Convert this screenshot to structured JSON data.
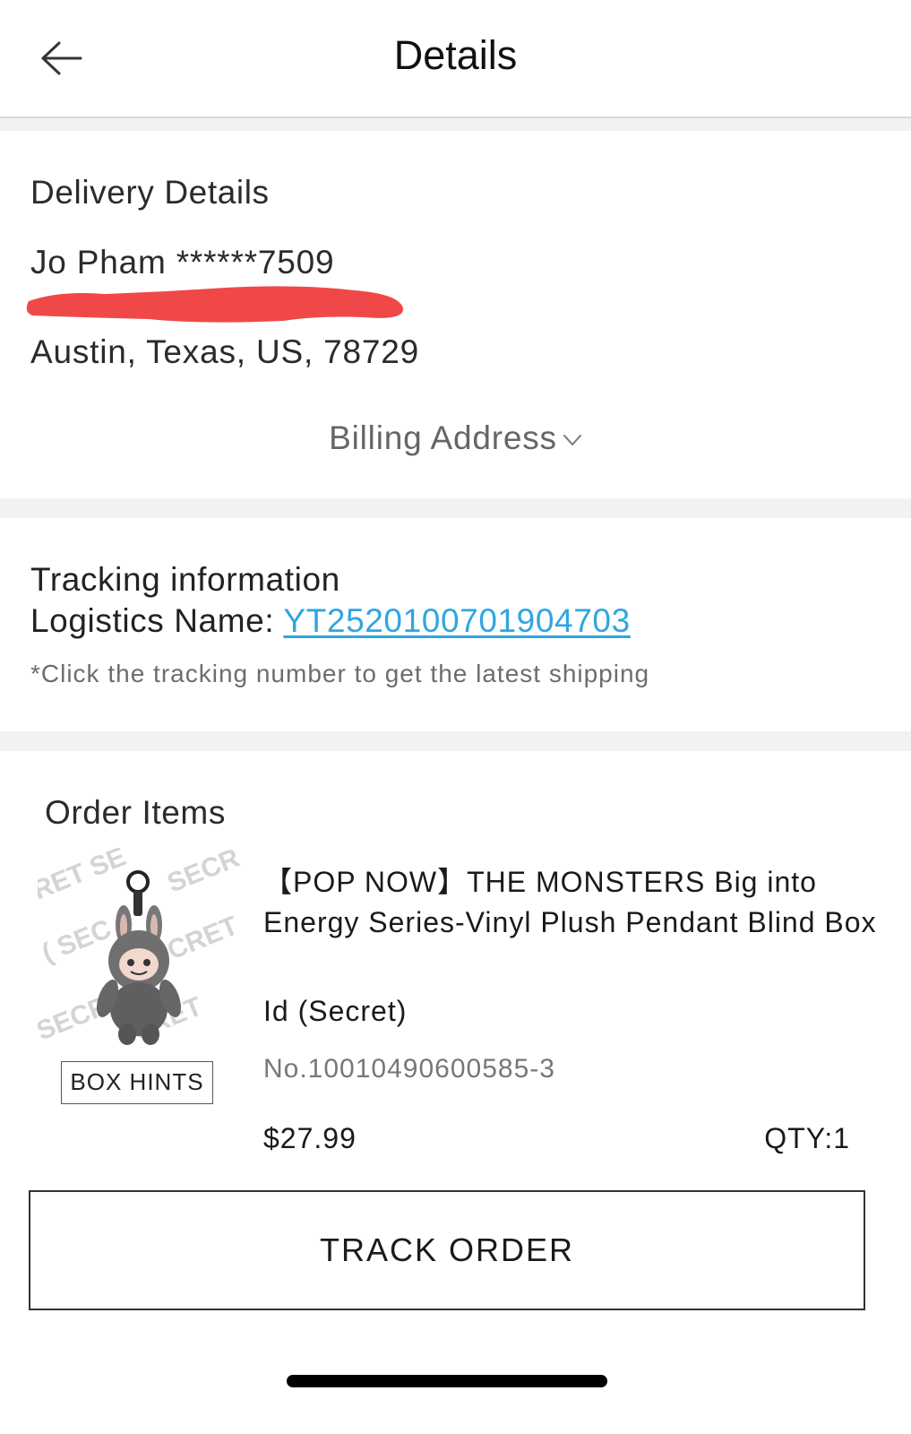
{
  "header": {
    "title": "Details",
    "back_icon": "arrow-left-icon"
  },
  "delivery": {
    "title": "Delivery Details",
    "name_phone": "Jo Pham ******7509",
    "address": "Austin, Texas, US, 78729",
    "billing_toggle": "Billing Address",
    "redaction_color": "#f04848"
  },
  "tracking": {
    "title": "Tracking information",
    "logistics_label": "Logistics Name: ",
    "tracking_number": "YT2520100701904703",
    "note": "*Click the tracking number to get the latest shipping",
    "link_color": "#2fa6e0"
  },
  "order": {
    "title": "Order Items",
    "box_hints": "BOX HINTS",
    "watermark_text": "SECRET",
    "item": {
      "name": "【POP NOW】THE MONSTERS Big into Energy Series-Vinyl Plush Pendant Blind Box",
      "variant": "Id (Secret)",
      "number": "No.10010490600585-3",
      "price": "$27.99",
      "qty": "QTY:1"
    },
    "track_button": "TRACK ORDER"
  }
}
